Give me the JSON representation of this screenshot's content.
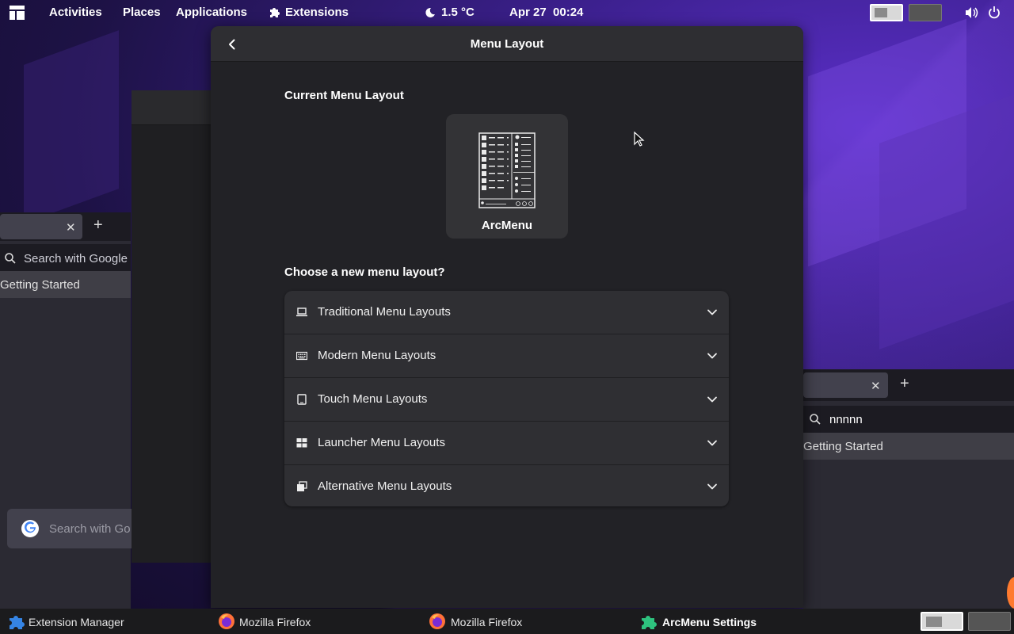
{
  "topbar": {
    "activities": "Activities",
    "places": "Places",
    "applications": "Applications",
    "extensions": "Extensions",
    "weather": "1.5 °C",
    "clock": "Apr 27  00:24"
  },
  "dialog": {
    "title": "Menu Layout",
    "current_section": "Current Menu Layout",
    "current_layout_name": "ArcMenu",
    "choose_section": "Choose a new menu layout?",
    "layout_groups": [
      {
        "label": "Traditional Menu Layouts",
        "icon": "laptop-icon"
      },
      {
        "label": "Modern Menu Layouts",
        "icon": "keyboard-icon"
      },
      {
        "label": "Touch Menu Layouts",
        "icon": "tablet-icon"
      },
      {
        "label": "Launcher Menu Layouts",
        "icon": "grid-icon"
      },
      {
        "label": "Alternative Menu Layouts",
        "icon": "windows-icon"
      }
    ]
  },
  "background_windows": {
    "left_search_placeholder": "Search with Google",
    "left_getting_started": "Getting Started",
    "left_google_search": "Search with Go",
    "right_url_value": "nnnnn",
    "right_getting_started": "Getting Started"
  },
  "taskbar": {
    "items": [
      {
        "label": "Extension Manager",
        "icon": "puzzle-icon"
      },
      {
        "label": "Mozilla Firefox",
        "icon": "firefox-icon"
      },
      {
        "label": "Mozilla Firefox",
        "icon": "firefox-icon"
      },
      {
        "label": "ArcMenu Settings",
        "icon": "puzzle-icon"
      }
    ]
  },
  "colors": {
    "dialog_bg": "#222226",
    "header_bg": "#2e2e32",
    "list_bg": "#2f2f33",
    "accent_puzzle_green": "#2ec27e",
    "accent_puzzle_blue": "#3584e4"
  }
}
